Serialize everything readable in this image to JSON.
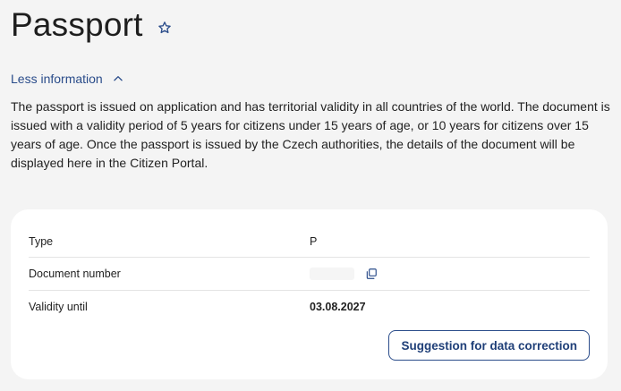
{
  "page": {
    "title": "Passport",
    "favorite_icon": "star-outline-icon"
  },
  "info_toggle": {
    "label": "Less information",
    "icon": "chevron-up-icon"
  },
  "description": "The passport is issued on application and has territorial validity in all countries of the world. The document is issued with a validity period of 5 years for citizens under 15 years of age, or 10 years for citizens over 15 years of age. Once the passport is issued by the Czech authorities, the details of the document will be displayed here in the Citizen Portal.",
  "details": {
    "type": {
      "label": "Type",
      "value": "P"
    },
    "document_number": {
      "label": "Document number",
      "value": "",
      "copy_icon": "copy-icon"
    },
    "validity": {
      "label": "Validity until",
      "value": "03.08.2027"
    }
  },
  "actions": {
    "suggest_correction": "Suggestion for data correction"
  },
  "colors": {
    "background": "#f4f4f4",
    "card": "#ffffff",
    "accent": "#2a4c8a",
    "text": "#222222"
  }
}
